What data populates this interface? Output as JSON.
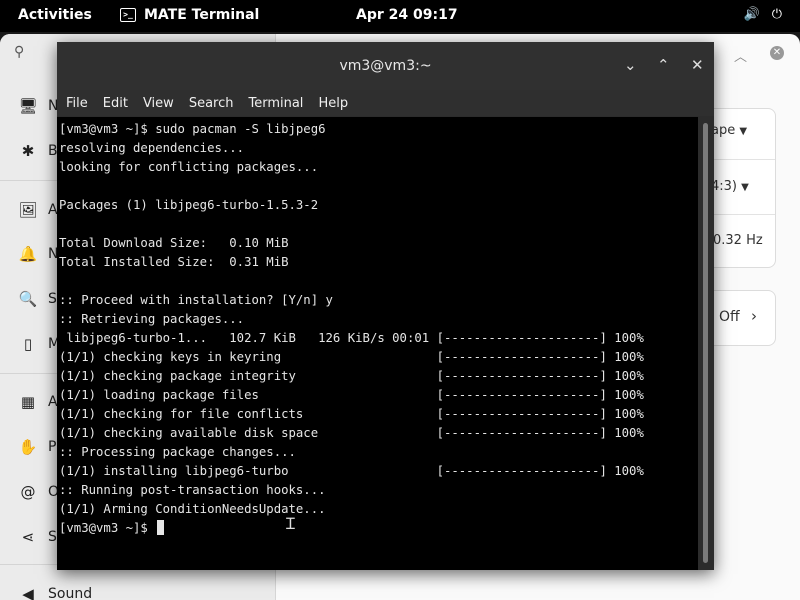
{
  "topbar": {
    "activities": "Activities",
    "app_name": "MATE Terminal",
    "app_icon": ">_",
    "clock": "Apr 24  09:17",
    "volume_icon": "🔊",
    "power_icon": "⏻"
  },
  "settings": {
    "sidebar_items": [
      {
        "label": "N",
        "icon": "🖥"
      },
      {
        "label": "B",
        "icon": "✱"
      },
      {
        "label": "A",
        "icon": "🖼"
      },
      {
        "label": "N",
        "icon": "🔔"
      },
      {
        "label": "S",
        "icon": "🔍"
      },
      {
        "label": "M",
        "icon": "▯"
      },
      {
        "label": "A",
        "icon": "▦"
      },
      {
        "label": "P",
        "icon": "✋"
      },
      {
        "label": "O",
        "icon": "@"
      },
      {
        "label": "S",
        "icon": "⋖"
      },
      {
        "label": "Sound",
        "icon": "◀"
      }
    ],
    "main_rows": [
      "ape",
      "4:3)",
      "0.32 Hz"
    ],
    "night_light_value": "Off"
  },
  "terminal": {
    "title": "vm3@vm3:~",
    "menu": [
      "File",
      "Edit",
      "View",
      "Search",
      "Terminal",
      "Help"
    ],
    "lines": [
      "[vm3@vm3 ~]$ sudo pacman -S libjpeg6",
      "resolving dependencies...",
      "looking for conflicting packages...",
      "",
      "Packages (1) libjpeg6-turbo-1.5.3-2",
      "",
      "Total Download Size:   0.10 MiB",
      "Total Installed Size:  0.31 MiB",
      "",
      ":: Proceed with installation? [Y/n] y",
      ":: Retrieving packages...",
      " libjpeg6-turbo-1...   102.7 KiB   126 KiB/s 00:01 [---------------------] 100%",
      "(1/1) checking keys in keyring                     [---------------------] 100%",
      "(1/1) checking package integrity                   [---------------------] 100%",
      "(1/1) loading package files                        [---------------------] 100%",
      "(1/1) checking for file conflicts                  [---------------------] 100%",
      "(1/1) checking available disk space                [---------------------] 100%",
      ":: Processing package changes...",
      "(1/1) installing libjpeg6-turbo                    [---------------------] 100%",
      ":: Running post-transaction hooks...",
      "(1/1) Arming ConditionNeedsUpdate...",
      "[vm3@vm3 ~]$ "
    ]
  }
}
